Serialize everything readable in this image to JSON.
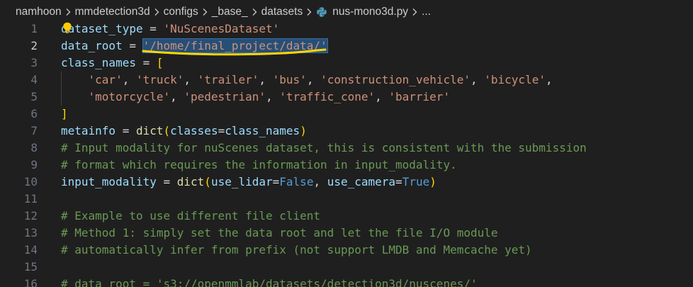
{
  "breadcrumb": {
    "items": [
      "namhoon",
      "mmdetection3d",
      "configs",
      "_base_",
      "datasets",
      "nus-mono3d.py"
    ],
    "ellipsis": "..."
  },
  "colors": {
    "background": "#1f1f1f",
    "string": "#ce9178",
    "comment": "#6a9955",
    "variable": "#9cdcfe",
    "function": "#dcdcaa",
    "keyword": "#569cd6",
    "selection": "#264f78",
    "annotation": "#ffd700"
  },
  "editor": {
    "active_line": 2,
    "selected_text": "'/home/final_project/data/'",
    "icons": [
      "python-file-icon",
      "lightbulb-icon"
    ],
    "lines": [
      {
        "n": "1",
        "t": [
          [
            "var",
            "dataset_type"
          ],
          [
            "op",
            " = "
          ],
          [
            "str",
            "'NuScenesDataset'"
          ]
        ]
      },
      {
        "n": "2",
        "t": [
          [
            "var",
            "data_root"
          ],
          [
            "op",
            " = "
          ],
          [
            "sel",
            "'/home/final_project/data/'"
          ]
        ]
      },
      {
        "n": "3",
        "t": [
          [
            "var",
            "class_names"
          ],
          [
            "op",
            " = "
          ],
          [
            "br",
            "["
          ]
        ]
      },
      {
        "n": "4",
        "t": [
          [
            "pn",
            "    "
          ],
          [
            "str",
            "'car'"
          ],
          [
            "pn",
            ", "
          ],
          [
            "str",
            "'truck'"
          ],
          [
            "pn",
            ", "
          ],
          [
            "str",
            "'trailer'"
          ],
          [
            "pn",
            ", "
          ],
          [
            "str",
            "'bus'"
          ],
          [
            "pn",
            ", "
          ],
          [
            "str",
            "'construction_vehicle'"
          ],
          [
            "pn",
            ", "
          ],
          [
            "str",
            "'bicycle'"
          ],
          [
            "pn",
            ","
          ]
        ]
      },
      {
        "n": "5",
        "t": [
          [
            "pn",
            "    "
          ],
          [
            "str",
            "'motorcycle'"
          ],
          [
            "pn",
            ", "
          ],
          [
            "str",
            "'pedestrian'"
          ],
          [
            "pn",
            ", "
          ],
          [
            "str",
            "'traffic_cone'"
          ],
          [
            "pn",
            ", "
          ],
          [
            "str",
            "'barrier'"
          ]
        ]
      },
      {
        "n": "6",
        "t": [
          [
            "br",
            "]"
          ]
        ]
      },
      {
        "n": "7",
        "t": [
          [
            "var",
            "metainfo"
          ],
          [
            "op",
            " = "
          ],
          [
            "fn",
            "dict"
          ],
          [
            "br",
            "("
          ],
          [
            "var",
            "classes"
          ],
          [
            "op",
            "="
          ],
          [
            "var",
            "class_names"
          ],
          [
            "br",
            ")"
          ]
        ]
      },
      {
        "n": "8",
        "t": [
          [
            "cm",
            "# Input modality for nuScenes dataset, this is consistent with the submission"
          ]
        ]
      },
      {
        "n": "9",
        "t": [
          [
            "cm",
            "# format which requires the information in input_modality."
          ]
        ]
      },
      {
        "n": "10",
        "t": [
          [
            "var",
            "input_modality"
          ],
          [
            "op",
            " = "
          ],
          [
            "fn",
            "dict"
          ],
          [
            "br",
            "("
          ],
          [
            "var",
            "use_lidar"
          ],
          [
            "op",
            "="
          ],
          [
            "kw",
            "False"
          ],
          [
            "pn",
            ", "
          ],
          [
            "var",
            "use_camera"
          ],
          [
            "op",
            "="
          ],
          [
            "kw",
            "True"
          ],
          [
            "br",
            ")"
          ]
        ]
      },
      {
        "n": "11",
        "t": []
      },
      {
        "n": "12",
        "t": [
          [
            "cm",
            "# Example to use different file client"
          ]
        ]
      },
      {
        "n": "13",
        "t": [
          [
            "cm",
            "# Method 1: simply set the data root and let the file I/O module"
          ]
        ]
      },
      {
        "n": "14",
        "t": [
          [
            "cm",
            "# automatically infer from prefix (not support LMDB and Memcache yet)"
          ]
        ]
      },
      {
        "n": "15",
        "t": []
      },
      {
        "n": "16",
        "t": [
          [
            "cm",
            "# data_root = 's3://openmmlab/datasets/detection3d/nuscenes/'"
          ]
        ]
      }
    ]
  }
}
